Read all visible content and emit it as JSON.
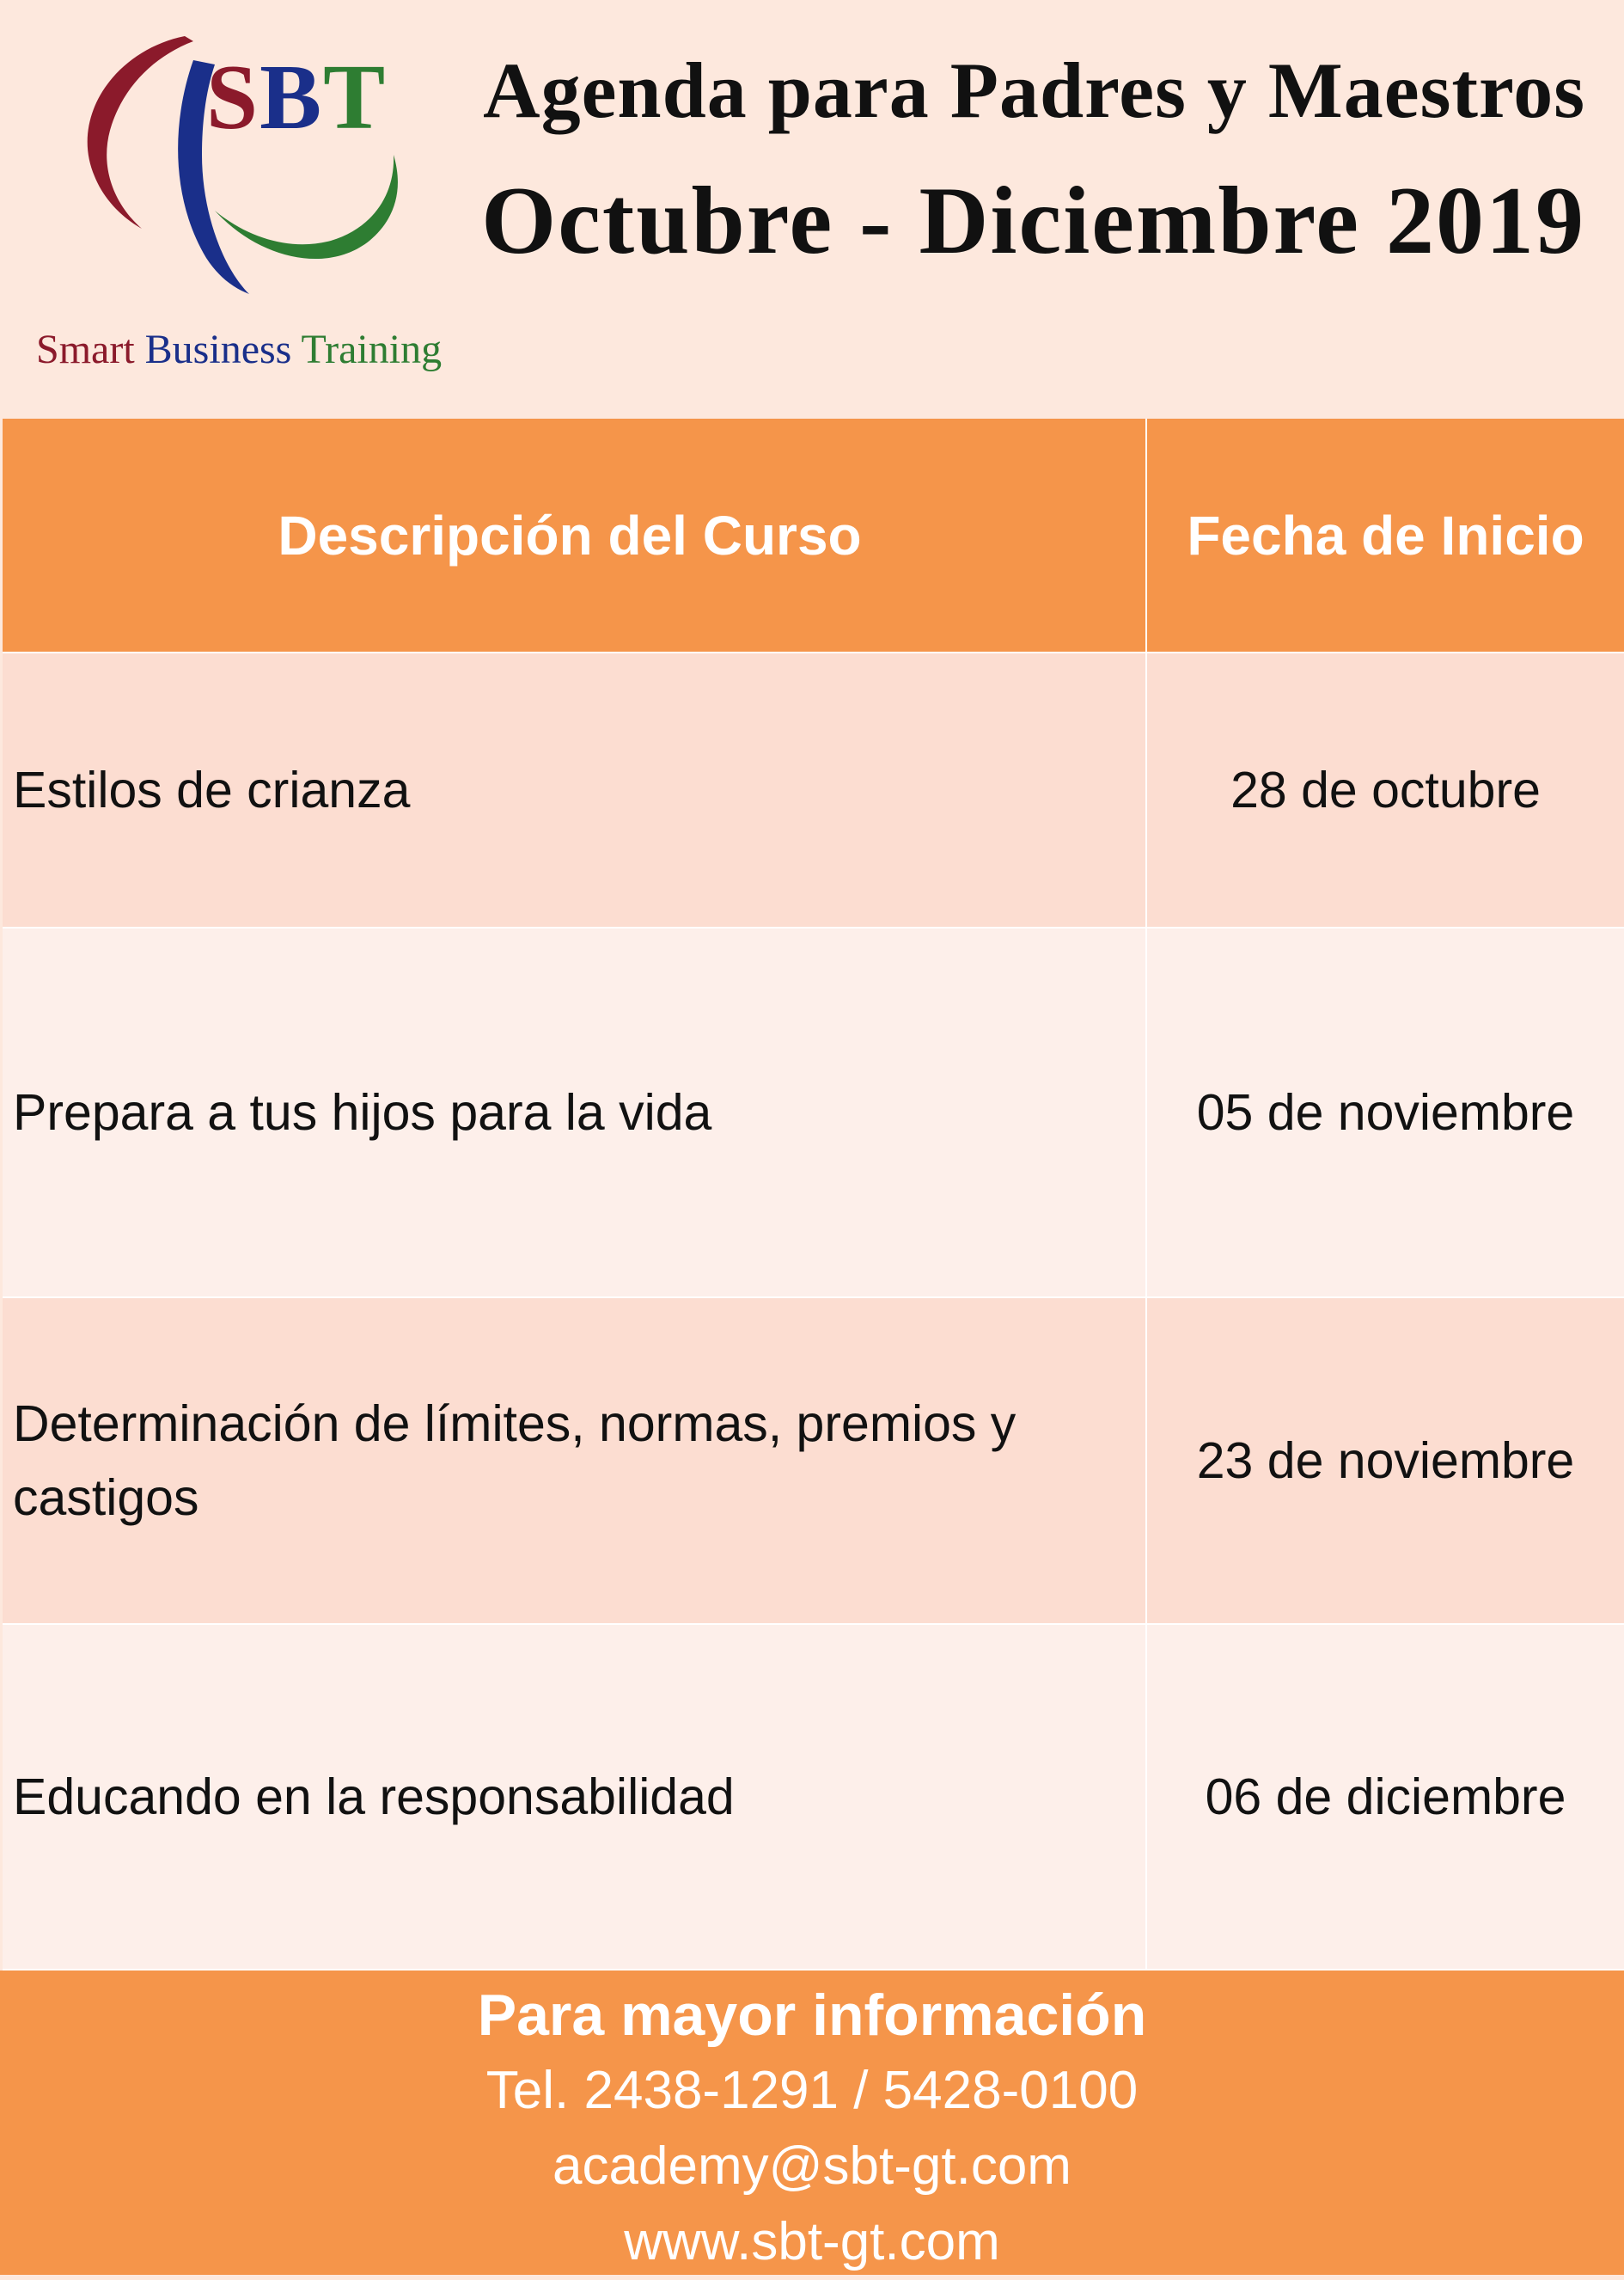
{
  "logo": {
    "initial_s": "S",
    "initial_b": "B",
    "initial_t": "T",
    "tagline_word1": "Smart",
    "tagline_word2": "Business",
    "tagline_word3": "Training",
    "colors": {
      "red": "#8b1a2b",
      "blue": "#1a2f8a",
      "green": "#2e7d32"
    }
  },
  "header": {
    "title_line1": "Agenda para Padres y Maestros",
    "title_line2": "Octubre - Diciembre 2019"
  },
  "table": {
    "columns": [
      "Descripción del Curso",
      "Fecha de Inicio"
    ],
    "rows": [
      {
        "course": "Estilos de crianza",
        "start_date": "28 de octubre"
      },
      {
        "course": "Prepara a tus hijos para la vida",
        "start_date": "05 de noviembre"
      },
      {
        "course": "Determinación de límites, normas, premios y castigos",
        "start_date": "23 de noviembre"
      },
      {
        "course": "Educando en la responsabilidad",
        "start_date": "06 de diciembre"
      }
    ]
  },
  "footer": {
    "heading": "Para mayor información",
    "phone": "Tel. 2438-1291 / 5428-0100",
    "email": "academy@sbt-gt.com",
    "website": "www.sbt-gt.com"
  },
  "colors": {
    "accent_orange": "#f5954a",
    "page_background": "#fde8dd",
    "row_odd": "#fcddd1",
    "row_even": "#fdefea"
  }
}
